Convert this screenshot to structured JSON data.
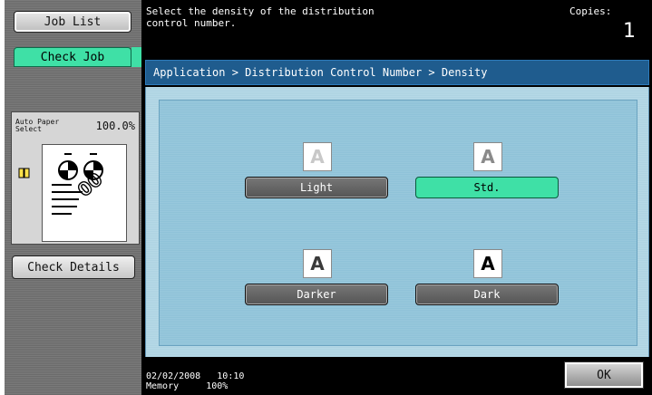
{
  "sidebar": {
    "job_list_label": "Job List",
    "check_job_label": "Check Job",
    "preview": {
      "auto_paper_line1": "Auto Paper",
      "auto_paper_line2": "Select",
      "zoom": "100.0%"
    },
    "check_details_label": "Check Details"
  },
  "message": {
    "text_line1": "Select the density of the distribution",
    "text_line2": "control number.",
    "copies_label": "Copies:",
    "copies_value": "1"
  },
  "breadcrumb": "Application > Distribution Control Number > Density",
  "options": [
    {
      "label": "Light",
      "sample": "A",
      "sample_color": "#c8c8c8",
      "selected": false
    },
    {
      "label": "Std.",
      "sample": "A",
      "sample_color": "#8a8a8a",
      "selected": true
    },
    {
      "label": "Darker",
      "sample": "A",
      "sample_color": "#3a3a3a",
      "selected": false
    },
    {
      "label": "Dark",
      "sample": "A",
      "sample_color": "#000000",
      "selected": false
    }
  ],
  "status": {
    "date": "02/02/2008",
    "time": "10:10",
    "memory_label": "Memory",
    "memory_value": "100%"
  },
  "ok_label": "OK",
  "colors": {
    "accent_selected": "#3fe0a6",
    "breadcrumb_bg": "#1f5c8e",
    "panel_bg": "#98c8dc"
  }
}
